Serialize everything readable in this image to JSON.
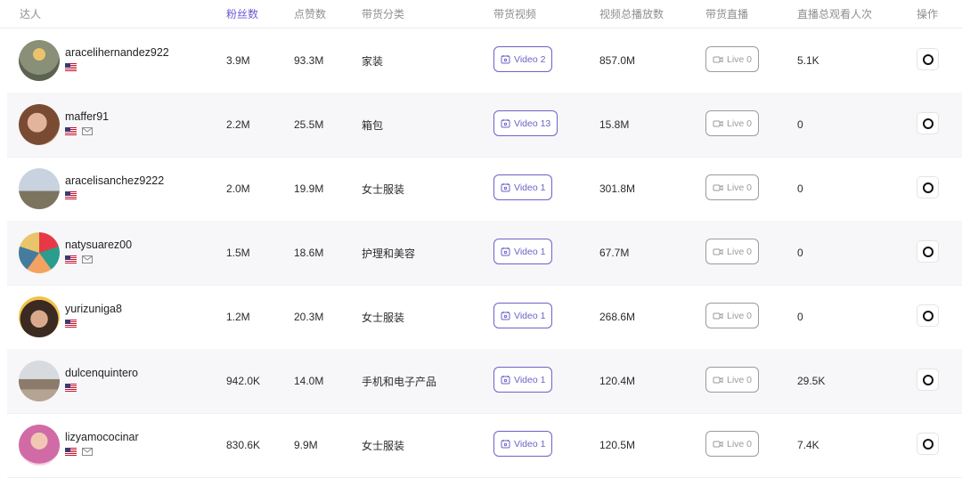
{
  "headers": {
    "creator": "达人",
    "followers": "粉丝数",
    "likes": "点赞数",
    "category": "带货分类",
    "videos": "带货视频",
    "views": "视频总播放数",
    "live": "带货直播",
    "live_views": "直播总观看人次",
    "action": "操作"
  },
  "colors": {
    "accent": "#6b5bd6",
    "button_border": "#6b63c8",
    "live_grey": "#9b9b9b"
  },
  "rows": [
    {
      "name": "aracelihernandez922",
      "email": false,
      "followers": "3.9M",
      "likes": "93.3M",
      "category": "家装",
      "video": "Video 2",
      "views": "857.0M",
      "live": "Live 0",
      "live_views": "5.1K"
    },
    {
      "name": "maffer91",
      "email": true,
      "followers": "2.2M",
      "likes": "25.5M",
      "category": "箱包",
      "video": "Video 13",
      "views": "15.8M",
      "live": "Live 0",
      "live_views": "0"
    },
    {
      "name": "aracelisanchez9222",
      "email": false,
      "followers": "2.0M",
      "likes": "19.9M",
      "category": "女士服装",
      "video": "Video 1",
      "views": "301.8M",
      "live": "Live 0",
      "live_views": "0"
    },
    {
      "name": "natysuarez00",
      "email": true,
      "followers": "1.5M",
      "likes": "18.6M",
      "category": "护理和美容",
      "video": "Video 1",
      "views": "67.7M",
      "live": "Live 0",
      "live_views": "0"
    },
    {
      "name": "yurizuniga8",
      "email": false,
      "followers": "1.2M",
      "likes": "20.3M",
      "category": "女士服装",
      "video": "Video 1",
      "views": "268.6M",
      "live": "Live 0",
      "live_views": "0"
    },
    {
      "name": "dulcenquintero",
      "email": false,
      "followers": "942.0K",
      "likes": "14.0M",
      "category": "手机和电子产品",
      "video": "Video 1",
      "views": "120.4M",
      "live": "Live 0",
      "live_views": "29.5K"
    },
    {
      "name": "lizyamococinar",
      "email": true,
      "followers": "830.6K",
      "likes": "9.9M",
      "category": "女士服装",
      "video": "Video 1",
      "views": "120.5M",
      "live": "Live 0",
      "live_views": "7.4K"
    }
  ]
}
